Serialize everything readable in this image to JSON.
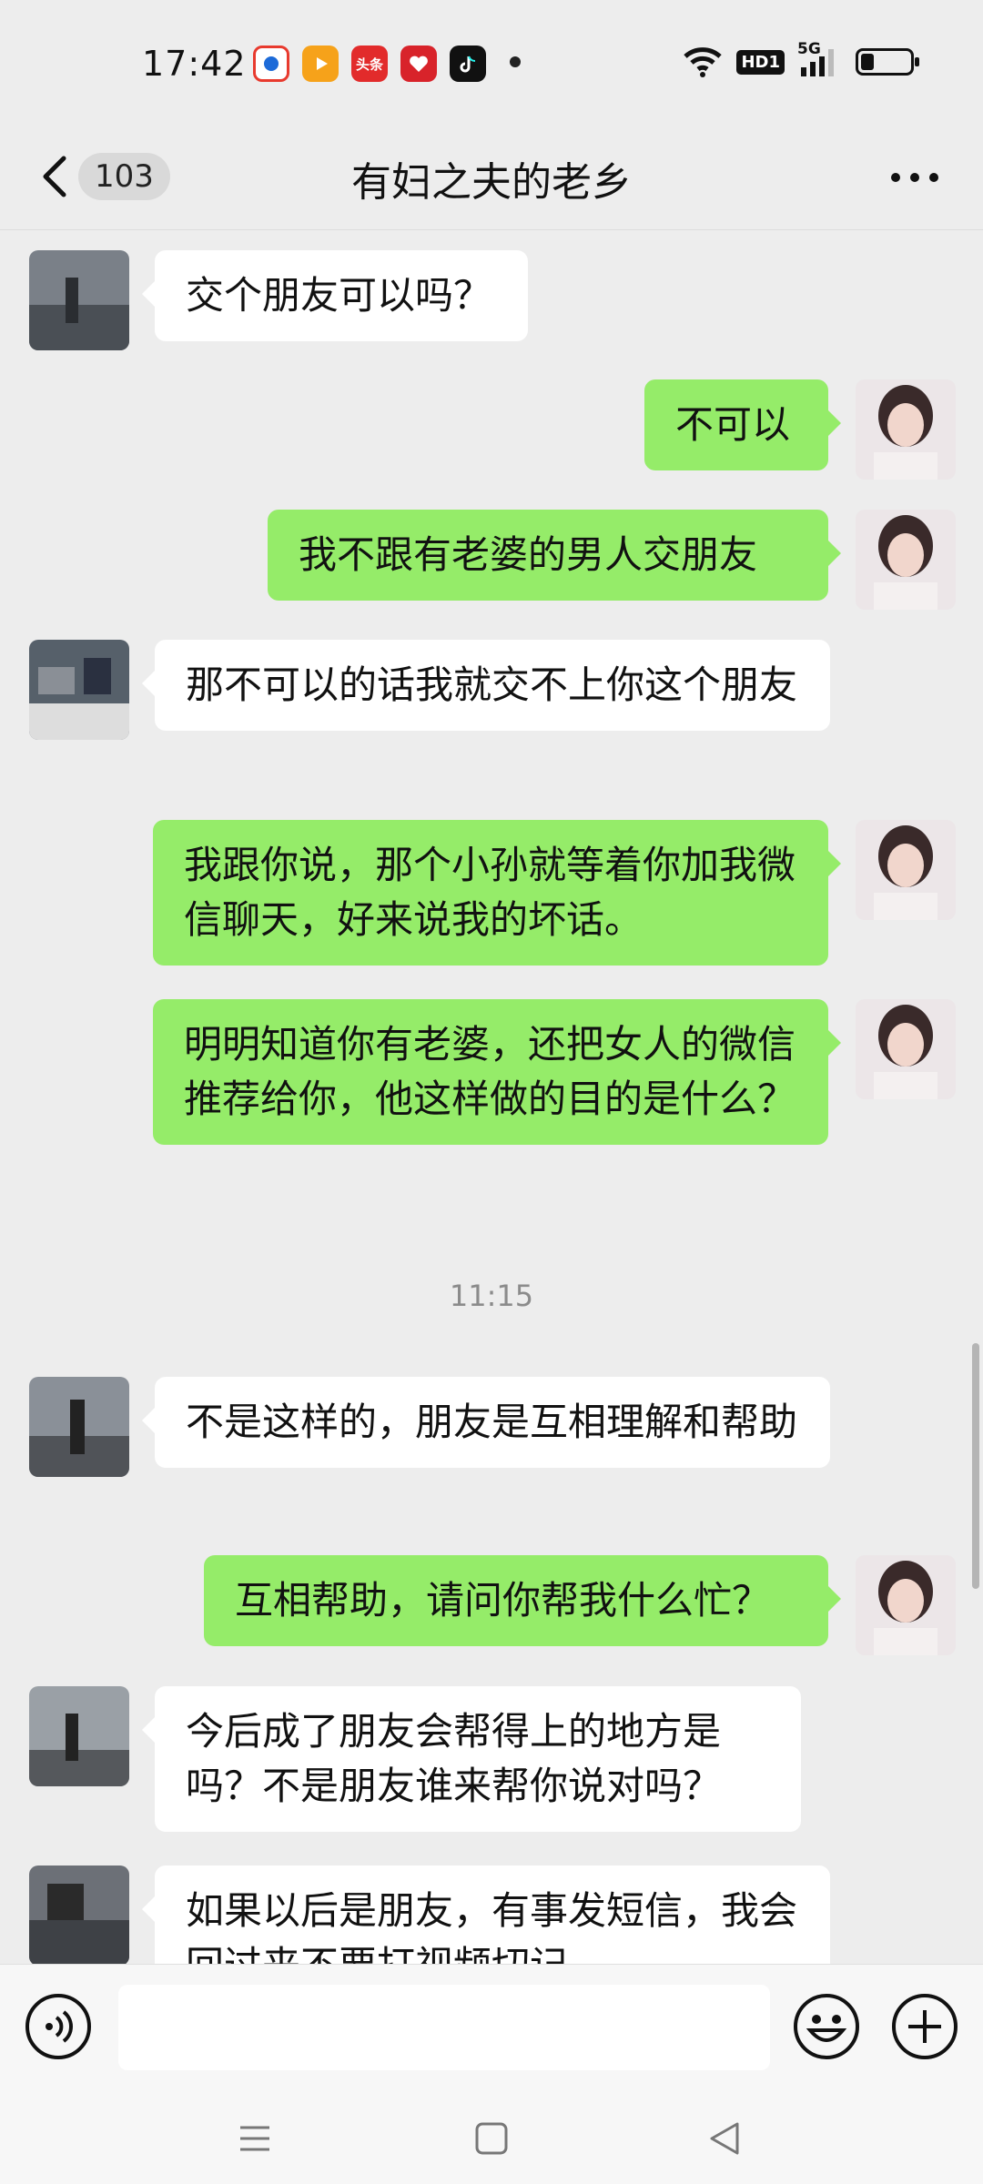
{
  "status_bar": {
    "time": "17:42",
    "app_icons": [
      {
        "name": "news-app-icon",
        "color": "#e83a2e"
      },
      {
        "name": "video-app-icon",
        "color": "#f6a21a"
      },
      {
        "name": "toutiao-app-icon",
        "color": "#e22b2b",
        "text": "头条"
      },
      {
        "name": "redheart-app-icon",
        "color": "#d8232a"
      },
      {
        "name": "tiktok-app-icon",
        "color": "#111111"
      }
    ],
    "hd_label": "HD1",
    "signal_label": "5G"
  },
  "header": {
    "back_badge": "103",
    "title": "有妇之夫的老乡"
  },
  "messages": [
    {
      "side": "in",
      "text": "交个朋友可以吗？"
    },
    {
      "side": "out",
      "text": "不可以"
    },
    {
      "side": "out",
      "text": "我不跟有老婆的男人交朋友"
    },
    {
      "side": "in",
      "text": "那不可以的话我就交不上你这个朋友"
    },
    {
      "side": "out",
      "text": "我跟你说，那个小孙就等着你加我微信聊天，好来说我的坏话。"
    },
    {
      "side": "out",
      "text": "明明知道你有老婆，还把女人的微信推荐给你，他这样做的目的是什么？"
    },
    {
      "side": "in",
      "text": "不是这样的，朋友是互相理解和帮助"
    },
    {
      "side": "out",
      "text": "互相帮助，请问你帮我什么忙？"
    },
    {
      "side": "in",
      "text": "今后成了朋友会帮得上的地方是吗？不是朋友谁来帮你说对吗？"
    },
    {
      "side": "in",
      "text": "如果以后是朋友，有事发短信，我会回过来不要打视频切记"
    }
  ],
  "timestamp": "11:15",
  "colors": {
    "background": "#ededed",
    "outgoing_bubble": "#95ec69",
    "incoming_bubble": "#ffffff"
  }
}
